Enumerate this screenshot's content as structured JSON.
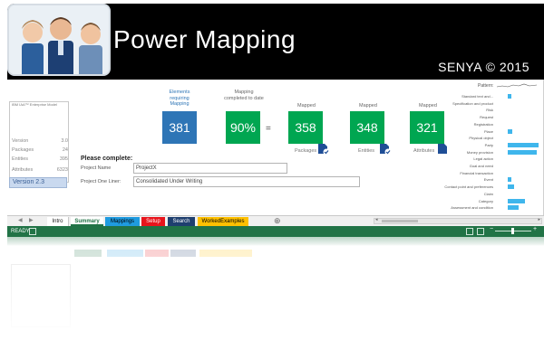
{
  "header": {
    "title": "Power Mapping",
    "copyright": "SENYA © 2015"
  },
  "model_panel": {
    "title": "IBM IAA™ Enterprise Model",
    "rows": [
      {
        "label": "Version",
        "value": "3.0"
      },
      {
        "label": "Packages",
        "value": "24"
      },
      {
        "label": "Entities",
        "value": "395"
      },
      {
        "label": "Attributes",
        "value": "6323"
      }
    ],
    "version_badge": "Version 2.3"
  },
  "stats": {
    "requiring": {
      "label": "Elements requiring Mapping",
      "value": "381"
    },
    "completed": {
      "label": "Mapping completed to date",
      "value": "90%"
    },
    "equals": "=",
    "packages": {
      "header": "Mapped",
      "value": "358",
      "sub": "Packages"
    },
    "entities": {
      "header": "Mapped",
      "value": "348",
      "sub": "Entities"
    },
    "attributes": {
      "header": "Mapped",
      "value": "321",
      "sub": "Attributes"
    }
  },
  "form": {
    "prompt": "Please complete:",
    "project_name_label": "Project Name",
    "project_name_value": "ProjectX",
    "one_liner_label": "Project One Liner:",
    "one_liner_value": "Consolidated Under Writing"
  },
  "pattern": {
    "label": "Pattern:",
    "rows": [
      {
        "name": "Standard text and...",
        "fraction": 0.12
      },
      {
        "name": "Specification and product",
        "fraction": 0.0
      },
      {
        "name": "Risk",
        "fraction": 0.0
      },
      {
        "name": "Request",
        "fraction": 0.0
      },
      {
        "name": "Registration",
        "fraction": 0.0
      },
      {
        "name": "Place",
        "fraction": 0.15
      },
      {
        "name": "Physical object",
        "fraction": 0.0
      },
      {
        "name": "Party",
        "fraction": 1.0
      },
      {
        "name": "Money provision",
        "fraction": 0.95
      },
      {
        "name": "Legal action",
        "fraction": 0.0
      },
      {
        "name": "Goal and need",
        "fraction": 0.0
      },
      {
        "name": "Financial transaction",
        "fraction": 0.0
      },
      {
        "name": "Event",
        "fraction": 0.12
      },
      {
        "name": "Contact point and preferences",
        "fraction": 0.22
      },
      {
        "name": "Claim",
        "fraction": 0.0
      },
      {
        "name": "Category",
        "fraction": 0.55
      },
      {
        "name": "Assessment and condition",
        "fraction": 0.35
      }
    ]
  },
  "tabs": [
    {
      "label": "Intro",
      "color": "#ffffff",
      "text": "#222222"
    },
    {
      "label": "Summary",
      "color": "#ffffff",
      "text": "#217346",
      "active": true
    },
    {
      "label": "Mappings",
      "color": "#1f9be0",
      "text": "#000000"
    },
    {
      "label": "Setup",
      "color": "#e8141c",
      "text": "#ffffff"
    },
    {
      "label": "Search",
      "color": "#1f3f6f",
      "text": "#ffffff"
    },
    {
      "label": "WorkedExamples",
      "color": "#ffc000",
      "text": "#000000"
    }
  ],
  "statusbar": {
    "text": "READY",
    "color": "#217346"
  },
  "colors": {
    "blue": "#2e75b6",
    "green": "#00a651",
    "pattern_bar": "#3fb6ec"
  }
}
